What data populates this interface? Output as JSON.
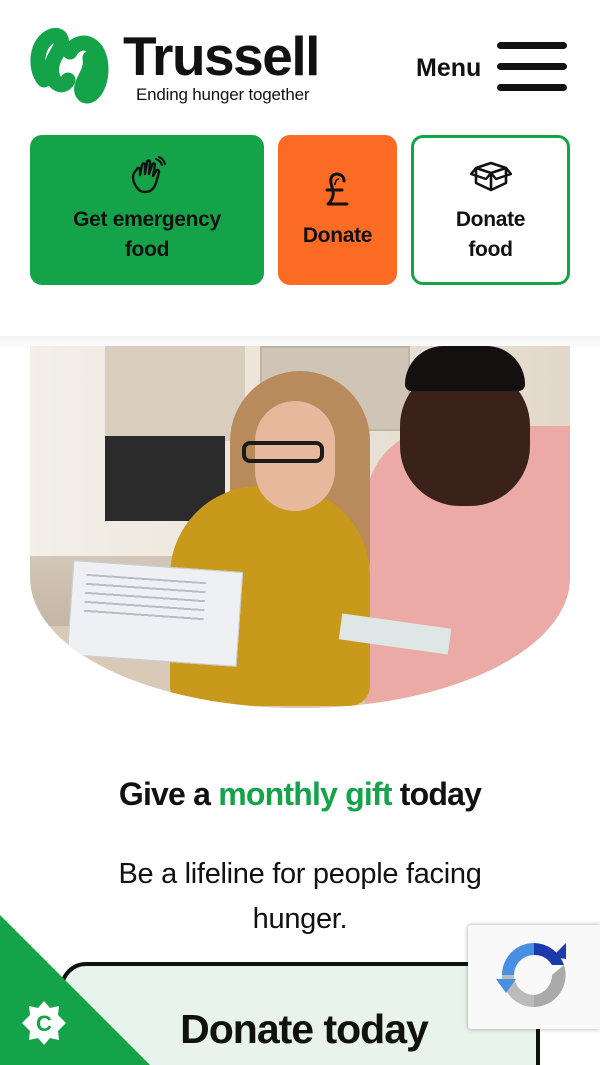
{
  "header": {
    "brand_name": "Trussell",
    "tagline": "Ending hunger together",
    "menu_label": "Menu"
  },
  "tiles": [
    {
      "label_line1": "Get emergency",
      "label_line2": "food",
      "icon": "waving-hand-icon"
    },
    {
      "label_line1": "Donate",
      "icon": "pound-sign-icon"
    },
    {
      "label_line1": "Donate",
      "label_line2": "food",
      "icon": "open-box-icon"
    }
  ],
  "colors": {
    "brand_green": "#15a34a",
    "donate_orange": "#fb6b23",
    "text": "#111111"
  },
  "hero": {
    "headline_before": "Give a ",
    "headline_highlight": "monthly gift",
    "headline_after": " today",
    "subtext": "Be a lifeline for people facing hunger."
  },
  "cta": {
    "donate_label": "Donate today"
  },
  "cookie": {
    "letter": "C"
  }
}
